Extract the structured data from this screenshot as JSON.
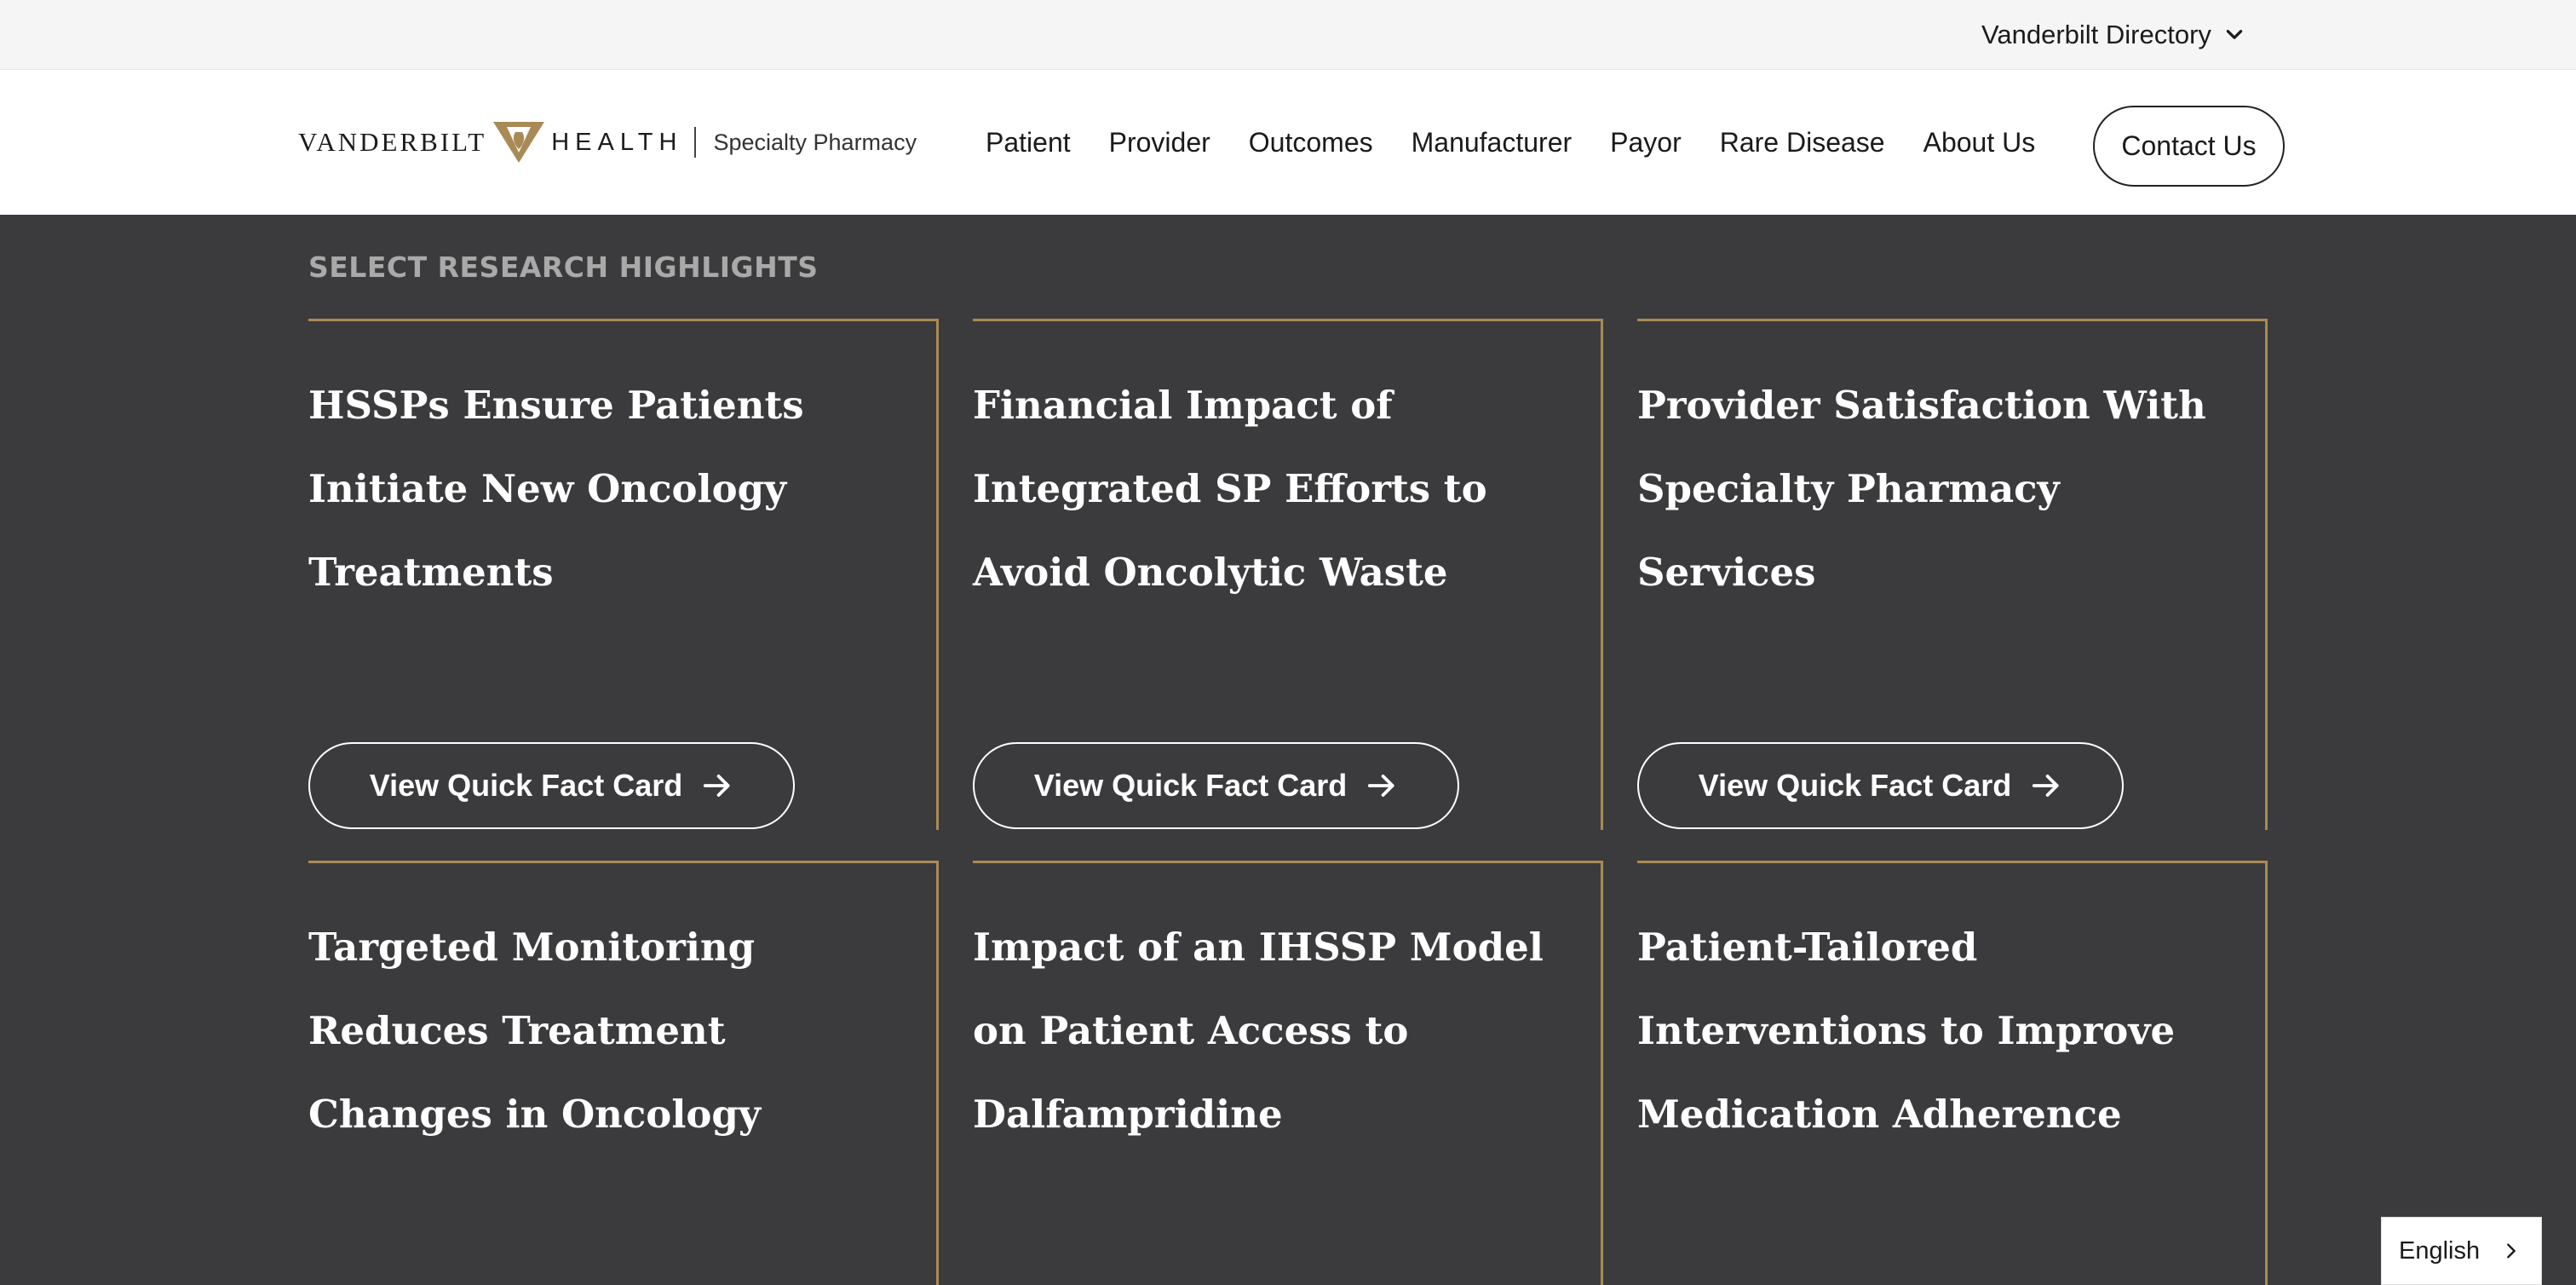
{
  "utility_bar": {
    "directory_label": "Vanderbilt Directory"
  },
  "header": {
    "logo": {
      "word1": "VANDERBILT",
      "word2": "HEALTH",
      "subtitle": "Specialty Pharmacy"
    },
    "nav": [
      "Patient",
      "Provider",
      "Outcomes",
      "Manufacturer",
      "Payor",
      "Rare Disease",
      "About Us"
    ],
    "contact_label": "Contact Us"
  },
  "main": {
    "section_heading": "SELECT RESEARCH HIGHLIGHTS",
    "cards": [
      {
        "title": "HSSPs Ensure Patients Initiate New Oncology Treatments",
        "button": "View Quick Fact Card"
      },
      {
        "title": "Financial Impact of Integrated SP Efforts to Avoid Oncolytic Waste",
        "button": "View Quick Fact Card"
      },
      {
        "title": "Provider Satisfaction With Specialty Pharmacy Services",
        "button": "View Quick Fact Card"
      },
      {
        "title": "Targeted Monitoring Reduces Treatment Changes in Oncology"
      },
      {
        "title": "Impact of an IHSSP Model on Patient Access to Dalfampridine"
      },
      {
        "title": "Patient-Tailored Interventions to Improve Medication Adherence"
      }
    ]
  },
  "language_selector": {
    "label": "English"
  },
  "colors": {
    "accent_gold": "#a98a56",
    "panel_dark": "#3b3b3d",
    "heading_gray": "#a9a9a9"
  },
  "icons": {
    "directory": "chevron-down-icon",
    "card_button": "arrow-right-icon",
    "language": "chevron-right-icon"
  }
}
